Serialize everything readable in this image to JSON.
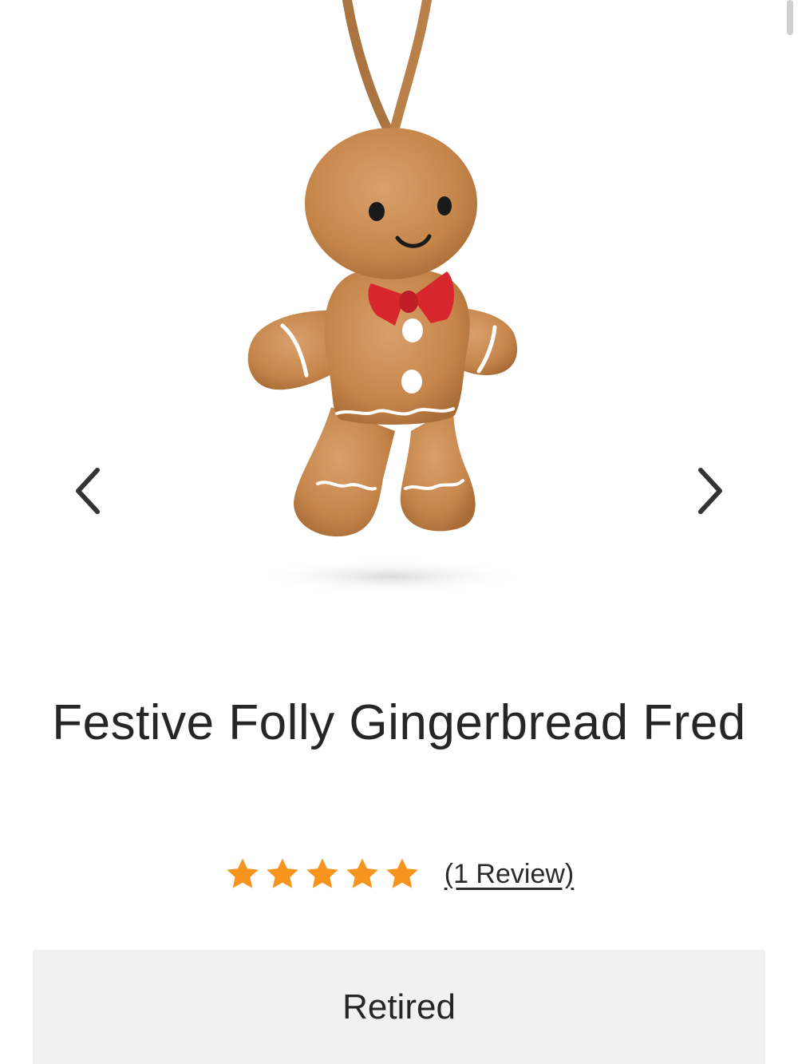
{
  "product": {
    "title": "Festive Folly Gingerbread Fred",
    "image_icon": "gingerbread-plush-image",
    "rating": 5,
    "rating_max": 5,
    "review_link": "(1 Review)",
    "status": "Retired"
  },
  "gallery": {
    "prev_icon": "chevron-left-icon",
    "next_icon": "chevron-right-icon"
  },
  "colors": {
    "star": "#f7941d",
    "status_bg": "#f1f1f1",
    "bow": "#d8262e",
    "plush": "#c98a4e",
    "ribbon": "#a9743f"
  }
}
